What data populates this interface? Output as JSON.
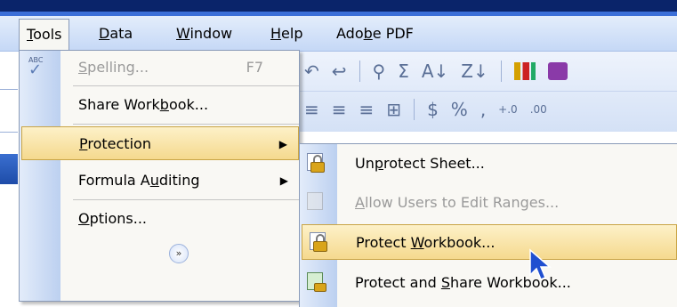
{
  "menubar": {
    "items": [
      {
        "pre": "",
        "mn": "T",
        "post": "ools"
      },
      {
        "pre": "",
        "mn": "D",
        "post": "ata"
      },
      {
        "pre": "",
        "mn": "W",
        "post": "indow"
      },
      {
        "pre": "",
        "mn": "H",
        "post": "elp"
      },
      {
        "pre": "Ado",
        "mn": "b",
        "post": "e PDF"
      }
    ]
  },
  "tools_menu": {
    "spelling": {
      "pre": "",
      "mn": "S",
      "post": "pelling...",
      "shortcut": "F7"
    },
    "share_workbook": {
      "pre": "Share Work",
      "mn": "b",
      "post": "ook..."
    },
    "protection": {
      "pre": "",
      "mn": "P",
      "post": "rotection"
    },
    "formula_auditing": {
      "pre": "Formula A",
      "mn": "u",
      "post": "diting"
    },
    "options": {
      "pre": "",
      "mn": "O",
      "post": "ptions..."
    },
    "spell_icon_text": "ABC"
  },
  "protection_submenu": {
    "unprotect_sheet": {
      "pre": "Un",
      "mn": "p",
      "post": "rotect Sheet..."
    },
    "allow_users": {
      "pre": "",
      "mn": "A",
      "post": "llow Users to Edit Ranges..."
    },
    "protect_workbook": {
      "pre": "Protect ",
      "mn": "W",
      "post": "orkbook..."
    },
    "protect_share": {
      "pre": "Protect and ",
      "mn": "S",
      "post": "hare Workbook..."
    }
  },
  "toolbar": {
    "row1": [
      "↩",
      "Σ",
      "A↓",
      "Z↓"
    ],
    "row2": [
      "$",
      "%",
      ",",
      "+.0",
      ".00"
    ]
  }
}
